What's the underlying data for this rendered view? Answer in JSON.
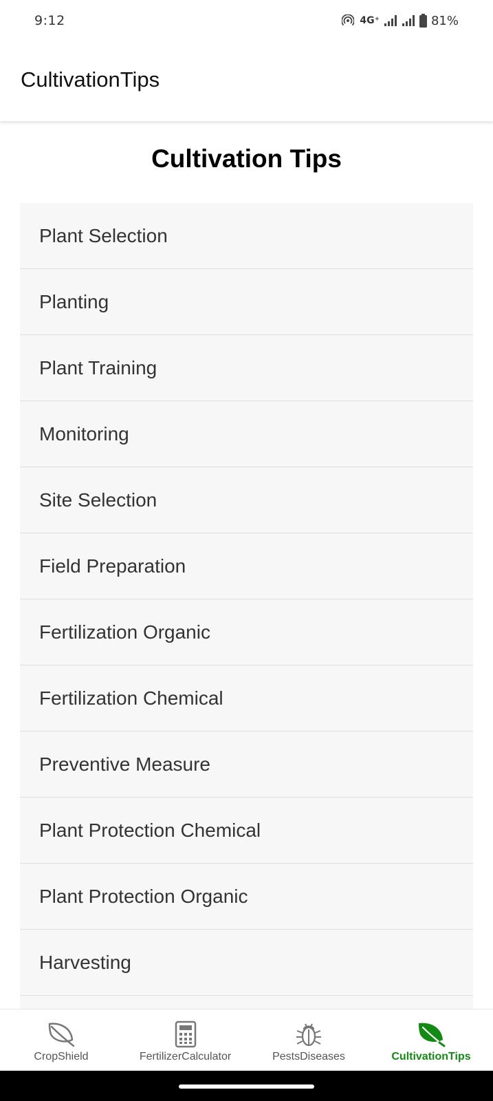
{
  "status_bar": {
    "time": "9:12",
    "network": "4G⁺",
    "battery": "81%"
  },
  "app_bar": {
    "title": "CultivationTips"
  },
  "page": {
    "heading": "Cultivation Tips",
    "tips": [
      "Plant Selection",
      "Planting",
      "Plant Training",
      "Monitoring",
      "Site Selection",
      "Field Preparation",
      "Fertilization Organic",
      "Fertilization Chemical",
      "Preventive Measure",
      "Plant Protection Chemical",
      "Plant Protection Organic",
      "Harvesting"
    ]
  },
  "bottom_nav": {
    "active_color": "#138a13",
    "inactive_color": "#555555",
    "tabs": [
      {
        "label": "CropShield",
        "icon": "leaf-outline-icon",
        "active": false
      },
      {
        "label": "FertilizerCalculator",
        "icon": "calculator-icon",
        "active": false
      },
      {
        "label": "PestsDiseases",
        "icon": "bug-icon",
        "active": false
      },
      {
        "label": "CultivationTips",
        "icon": "leaf-filled-icon",
        "active": true
      }
    ]
  }
}
